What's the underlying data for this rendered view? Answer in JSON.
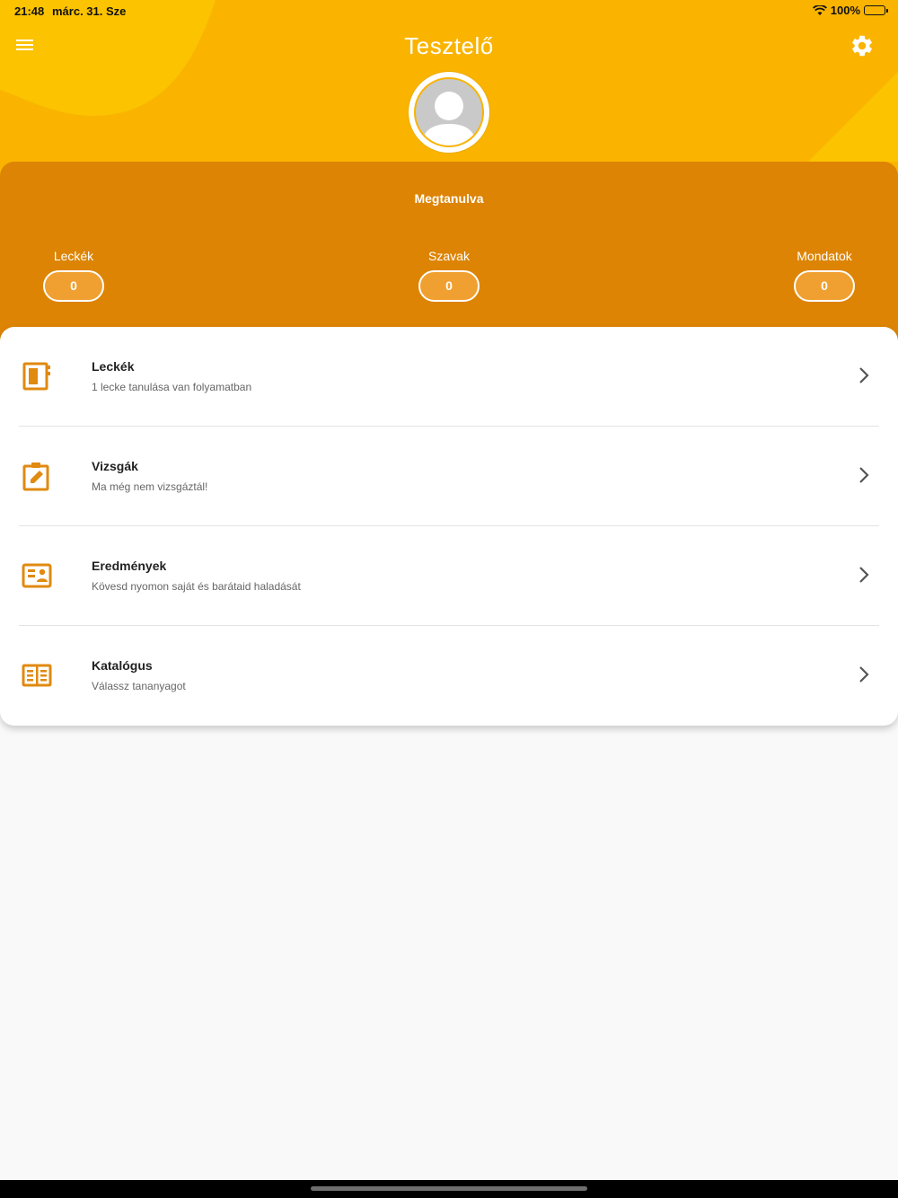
{
  "status_bar": {
    "time": "21:48",
    "date": "márc. 31. Sze",
    "battery_text": "100%"
  },
  "header": {
    "title": "Tesztelő",
    "menu_icon": "hamburger-menu-icon",
    "settings_icon": "gear-icon",
    "avatar_icon": "user-avatar-icon"
  },
  "stats": {
    "title": "Megtanulva",
    "items": [
      {
        "label": "Leckék",
        "value": "0"
      },
      {
        "label": "Szavak",
        "value": "0"
      },
      {
        "label": "Mondatok",
        "value": "0"
      }
    ]
  },
  "menu": {
    "items": [
      {
        "title": "Leckék",
        "subtitle": "1 lecke tanulása van folyamatban",
        "icon": "notebook-icon"
      },
      {
        "title": "Vizsgák",
        "subtitle": "Ma még nem vizsgáztál!",
        "icon": "clipboard-edit-icon"
      },
      {
        "title": "Eredmények",
        "subtitle": "Kövesd nyomon saját és barátaid haladását",
        "icon": "contact-card-icon"
      },
      {
        "title": "Katalógus",
        "subtitle": "Válassz tananyagot",
        "icon": "open-book-icon"
      }
    ]
  },
  "colors": {
    "header_yellow": "#fab400",
    "stats_orange": "#dd8404",
    "accent_orange": "#e08a10"
  }
}
